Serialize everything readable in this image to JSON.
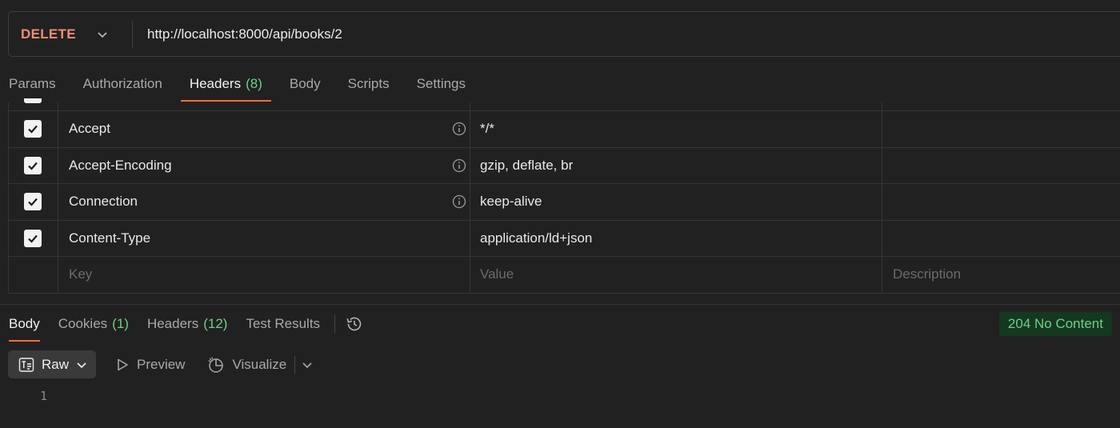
{
  "request": {
    "method": "DELETE",
    "url": "http://localhost:8000/api/books/2"
  },
  "request_tabs": [
    {
      "label": "Params",
      "count": ""
    },
    {
      "label": "Authorization",
      "count": ""
    },
    {
      "label": "Headers",
      "count": "(8)"
    },
    {
      "label": "Body",
      "count": ""
    },
    {
      "label": "Scripts",
      "count": ""
    },
    {
      "label": "Settings",
      "count": ""
    }
  ],
  "headers_table": {
    "rows": [
      {
        "key": "Accept",
        "value": "*/*",
        "description": ""
      },
      {
        "key": "Accept-Encoding",
        "value": "gzip, deflate, br",
        "description": ""
      },
      {
        "key": "Connection",
        "value": "keep-alive",
        "description": ""
      },
      {
        "key": "Content-Type",
        "value": "application/ld+json",
        "description": ""
      }
    ],
    "placeholder": {
      "key": "Key",
      "value": "Value",
      "description": "Description"
    }
  },
  "response_tabs": [
    {
      "label": "Body",
      "count": ""
    },
    {
      "label": "Cookies",
      "count": "(1)"
    },
    {
      "label": "Headers",
      "count": "(12)"
    },
    {
      "label": "Test Results",
      "count": ""
    }
  ],
  "status": "204 No Content",
  "response_toolbar": {
    "raw_label": "Raw",
    "preview_label": "Preview",
    "visualize_label": "Visualize"
  },
  "body_lines": [
    "1"
  ],
  "colors": {
    "method": "#f08d77",
    "accent": "#ff6c37",
    "count": "#6fcf87",
    "status_bg": "#143820",
    "status_fg": "#6fcf87"
  }
}
